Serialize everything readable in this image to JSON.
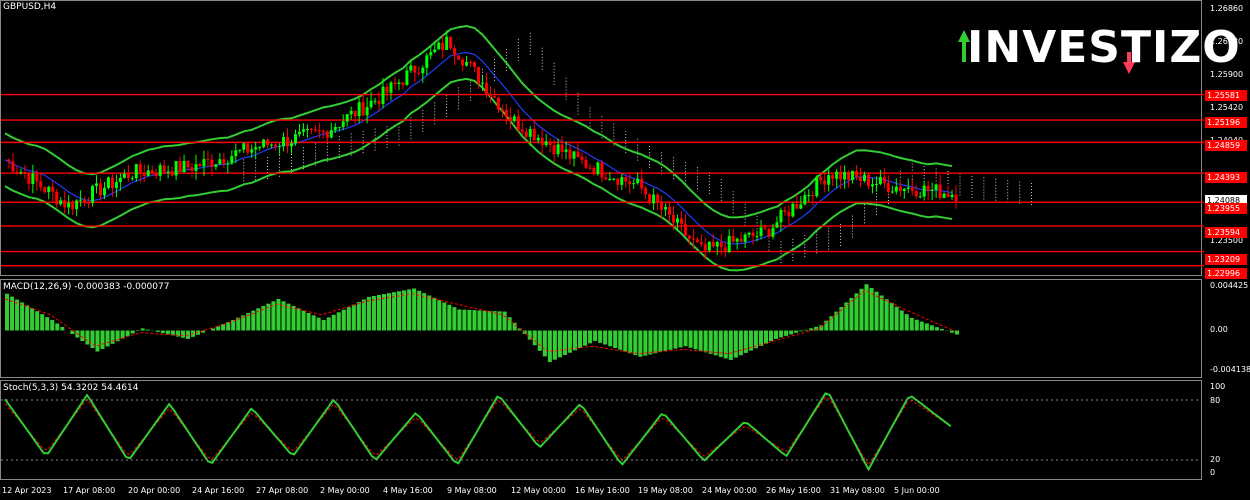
{
  "symbol_label": "GBPUSD,H4",
  "logo_text": "INVESTIZO",
  "colors": {
    "background": "#000000",
    "bull_candle": "#00ff00",
    "bear_candle": "#ff0000",
    "level_line": "#ff0000",
    "bollinger": "#32cd32",
    "ma_blue": "#1e3cff",
    "macd_hist": "#32cd32",
    "stoch_main": "#32cd32",
    "stoch_signal": "#ff0000",
    "logo_arrow_up": "#32cd32",
    "logo_arrow_down": "#ff3b5c"
  },
  "price_axis": {
    "ticks": [
      "1.26860",
      "1.26380",
      "1.25900",
      "1.25420",
      "1.24940",
      "1.23500"
    ],
    "current_price": "1.24088",
    "levels": [
      "1.25581",
      "1.25196",
      "1.24859",
      "1.24393",
      "1.23955",
      "1.23594",
      "1.23209",
      "1.22996"
    ]
  },
  "macd": {
    "label": "MACD(12,26,9) -0.000383 -0.000077",
    "ticks": [
      "0.004425",
      "0.00",
      "-0.004138"
    ]
  },
  "stoch": {
    "label": "Stoch(5,3,3) 54.3202 54.4614",
    "ticks": [
      "100",
      "80",
      "20",
      "0"
    ]
  },
  "time_axis": [
    "12 Apr 2023",
    "17 Apr 08:00",
    "20 Apr 00:00",
    "24 Apr 16:00",
    "27 Apr 08:00",
    "2 May 00:00",
    "4 May 16:00",
    "9 May 08:00",
    "12 May 00:00",
    "16 May 16:00",
    "19 May 08:00",
    "24 May 00:00",
    "26 May 16:00",
    "31 May 08:00",
    "5 Jun 00:00"
  ],
  "chart_data": [
    {
      "type": "candlestick",
      "title": "GBPUSD,H4",
      "ylim": [
        1.229,
        1.2695
      ],
      "horizontal_levels": [
        1.25581,
        1.25196,
        1.24859,
        1.24393,
        1.23955,
        1.23594,
        1.23209,
        1.22996
      ],
      "last_price": 1.24088,
      "close_path": [
        {
          "x": "12 Apr 2023",
          "y": 1.246
        },
        {
          "x": "17 Apr 08:00",
          "y": 1.239
        },
        {
          "x": "20 Apr 00:00",
          "y": 1.244
        },
        {
          "x": "24 Apr 16:00",
          "y": 1.245
        },
        {
          "x": "27 Apr 08:00",
          "y": 1.248
        },
        {
          "x": "2 May 00:00",
          "y": 1.25
        },
        {
          "x": "4 May 16:00",
          "y": 1.256
        },
        {
          "x": "9 May 08:00",
          "y": 1.264
        },
        {
          "x": "12 May 00:00",
          "y": 1.252
        },
        {
          "x": "16 May 16:00",
          "y": 1.246
        },
        {
          "x": "19 May 08:00",
          "y": 1.242
        },
        {
          "x": "24 May 00:00",
          "y": 1.232
        },
        {
          "x": "26 May 16:00",
          "y": 1.235
        },
        {
          "x": "31 May 08:00",
          "y": 1.244
        },
        {
          "x": "5 Jun 00:00",
          "y": 1.242
        },
        {
          "x": "last",
          "y": 1.24088
        }
      ]
    },
    {
      "type": "bar",
      "title": "MACD(12,26,9) -0.000383 -0.000077",
      "ylim": [
        -0.004138,
        0.004425
      ],
      "series": [
        {
          "name": "MACD",
          "values": [
            0.0035,
            0.001,
            -0.002,
            0.0002,
            -0.0008,
            0.001,
            0.003,
            0.001,
            0.0032,
            0.004,
            0.002,
            0.0018,
            -0.003,
            -0.001,
            -0.0025,
            -0.0015,
            -0.0028,
            -0.0008,
            0.0005,
            0.0044,
            0.0012,
            -0.000383
          ]
        },
        {
          "name": "Signal",
          "values": [
            0.003,
            0.0015,
            -0.0015,
            -0.0002,
            -0.0005,
            0.0008,
            0.0025,
            0.0015,
            0.0028,
            0.0035,
            0.0025,
            0.0015,
            -0.002,
            -0.0015,
            -0.0022,
            -0.0018,
            -0.0022,
            -0.001,
            0.0002,
            0.0038,
            0.0018,
            -7.7e-05
          ]
        }
      ]
    },
    {
      "type": "line",
      "title": "Stoch(5,3,3) 54.3202 54.4614",
      "ylim": [
        0,
        100
      ],
      "levels": [
        80,
        20
      ],
      "series": [
        {
          "name": "Main",
          "values": [
            85,
            20,
            90,
            15,
            80,
            10,
            75,
            20,
            85,
            15,
            70,
            10,
            90,
            30,
            80,
            10,
            70,
            15,
            60,
            20,
            95,
            5,
            90,
            54.3202
          ]
        },
        {
          "name": "Signal",
          "values": [
            80,
            25,
            85,
            20,
            75,
            15,
            70,
            25,
            80,
            20,
            65,
            15,
            85,
            35,
            75,
            15,
            65,
            20,
            55,
            25,
            90,
            10,
            85,
            54.4614
          ]
        }
      ]
    }
  ]
}
